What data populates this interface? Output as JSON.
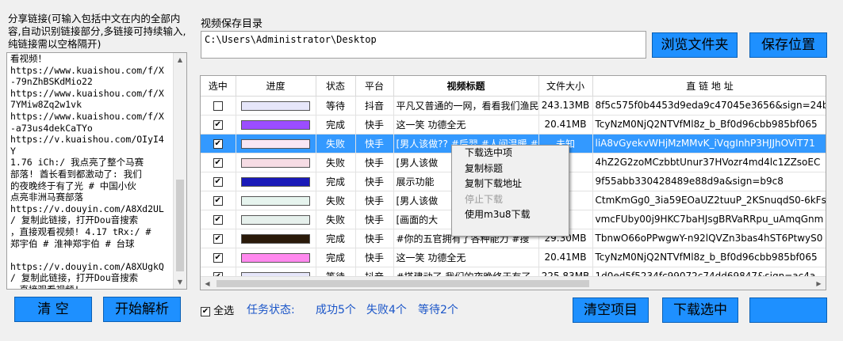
{
  "left_panel": {
    "label": "分享链接(可输入包括中文在内的全部内容,自动识别链接部分,多链接可持续输入,纯链接需以空格隔开)",
    "url_text": "看视频！\nhttps://www.kuaishou.com/f/X\n-79nZhBSKdMio22\nhttps://www.kuaishou.com/f/X\n7YMiw8Zq2w1vk\nhttps://www.kuaishou.com/f/X\n-a73us4dekCaTYo\nhttps://v.kuaishou.com/OIyI4\nY\n1.76 iCh:/ 我点亮了整个马赛\n部落! 酋长看到都激动了: 我们\n的夜晚终于有了光 # 中国小伙\n点亮非洲马赛部落\nhttps://v.douyin.com/A8Xd2UL\n/ 复制此链接，打开Dou音搜索\n，直接观看视频! 4.17 tRx:/ #\n郑宇伯 # 淮神郑宇伯 # 台球\n\nhttps://v.douyin.com/A8XUgkQ\n/ 复制此链接，打开Dou音搜索\n，直接观看视频!",
    "clear_button": "清  空",
    "parse_button": "开始解析"
  },
  "save_dir": {
    "label": "视频保存目录",
    "value": "C:\\Users\\Administrator\\Desktop",
    "browse_button": "浏览文件夹",
    "save_button": "保存位置"
  },
  "table": {
    "headers": [
      "选中",
      "进度",
      "状态",
      "平台",
      "视频标题",
      "文件大小",
      "直 链 地 址"
    ],
    "rows": [
      {
        "checked": false,
        "progress_color": "#e6e6fa",
        "status": "等待",
        "platform": "抖音",
        "title": "平凡又普通的一网，看看我们渔民",
        "size": "243.13MB",
        "link": "8f5c575f0b4453d9eda9c47045e3656&sign=24b"
      },
      {
        "checked": true,
        "progress_color": "#9b4dff",
        "status": "完成",
        "platform": "快手",
        "title": "这一笑 功德全无",
        "size": "20.41MB",
        "link": "TcyNzM0NjQ2NTVfMl8z_b_Bf0d96cbb985bf065"
      },
      {
        "checked": true,
        "progress_color": "#f8e6f4",
        "status": "失败",
        "platform": "快手",
        "title": "[男人该做?? #后羿 #人间温暖 #展",
        "size": "未知",
        "link": "liA8vGyekvWHjMzMMvK_iVqgInhP3HJJhOViT71"
      },
      {
        "checked": true,
        "progress_color": "#f6dce4",
        "status": "失败",
        "platform": "快手",
        "title": "[男人该做",
        "size": "",
        "link": "4hZ2G2zoMCzbbtUnur37HVozr4md4lc1ZZsoEC"
      },
      {
        "checked": true,
        "progress_color": "#1a1ab8",
        "status": "完成",
        "platform": "快手",
        "title": "展示功能",
        "size": "",
        "link": "9f55abb330428489e88d9a&sign=b9c8"
      },
      {
        "checked": true,
        "progress_color": "#e6f4ee",
        "status": "失败",
        "platform": "快手",
        "title": "[男人该做",
        "size": "",
        "link": "CtmKmGg0_3ia59EOaUZ2tuuP_2KSnuqdS0-6kFsa"
      },
      {
        "checked": true,
        "progress_color": "#e6f0ec",
        "status": "失败",
        "platform": "快手",
        "title": "[画面的大",
        "size": "",
        "link": "vmcFUby00j9HKC7baHJsgBRVaRRpu_uAmqGnm"
      },
      {
        "checked": true,
        "progress_color": "#2a1a0a",
        "status": "完成",
        "platform": "快手",
        "title": "#你的五官拥有了各种能力 #搜",
        "size": "29.30MB",
        "link": "TbnwO66oPPwgwY-n92lQVZn3bas4hST6PtwyS0"
      },
      {
        "checked": true,
        "progress_color": "#ff88ee",
        "status": "完成",
        "platform": "快手",
        "title": "这一笑 功德全无",
        "size": "20.41MB",
        "link": "TcyNzM0NjQ2NTVfMl8z_b_Bf0d96cbb985bf065"
      },
      {
        "checked": true,
        "progress_color": "#e6e6fa",
        "status": "等待",
        "platform": "抖音",
        "title": "#搭建动了 我们的夜晚终于有了",
        "size": "225.83MB",
        "link": "1d0ed5f5234fc99072c74dd69847&sign=ac4a"
      }
    ]
  },
  "context_menu": {
    "items": [
      "下载选中项",
      "复制标题",
      "复制下载地址",
      "停止下载",
      "使用m3u8下载"
    ]
  },
  "footer": {
    "select_all": "全选",
    "task_status": "任务状态:",
    "success": "成功5个",
    "failed": "失败4个",
    "waiting": "等待2个",
    "clear_items_button": "清空项目",
    "download_selected_button": "下载选中"
  },
  "colors": {
    "accent_blue": "#1e90ff",
    "selected_row": "#3399ff",
    "status_text": "#1a55c8"
  }
}
